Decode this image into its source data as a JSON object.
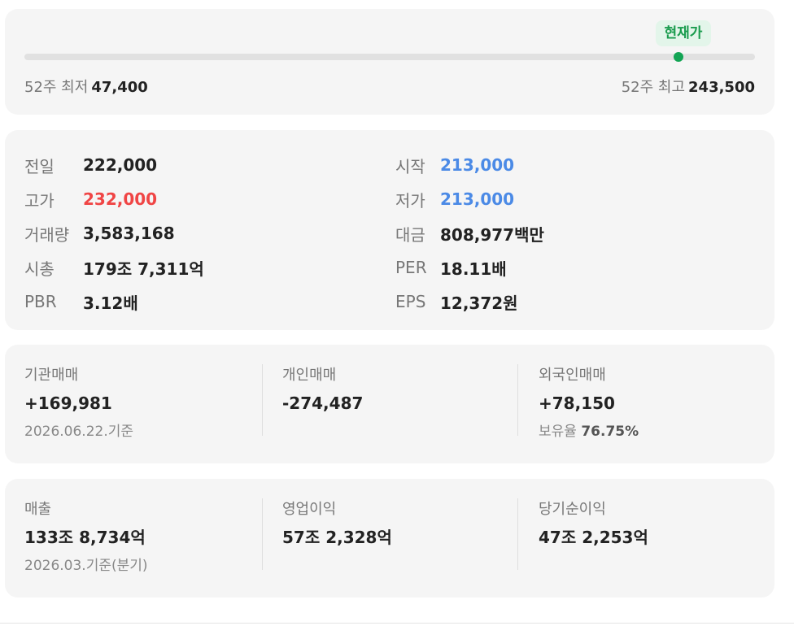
{
  "range": {
    "current_badge": "현재가",
    "current_position": 0.895,
    "low_label": "52주 최저",
    "low_value": "47,400",
    "high_label": "52주 최고",
    "high_value": "243,500",
    "track_color": "#e1e1e1",
    "dot_color": "#13a454"
  },
  "stats": {
    "left": [
      {
        "label": "전일",
        "value": "222,000",
        "color": "default"
      },
      {
        "label": "고가",
        "value": "232,000",
        "color": "red"
      },
      {
        "label": "거래량",
        "value": "3,583,168",
        "color": "default"
      },
      {
        "label": "시총",
        "value": "179조 7,311억",
        "color": "default"
      },
      {
        "label": "PBR",
        "value": "3.12배",
        "color": "default"
      }
    ],
    "right": [
      {
        "label": "시작",
        "value": "213,000",
        "color": "blue"
      },
      {
        "label": "저가",
        "value": "213,000",
        "color": "blue"
      },
      {
        "label": "대금",
        "value": "808,977백만",
        "color": "default"
      },
      {
        "label": "PER",
        "value": "18.11배",
        "color": "default"
      },
      {
        "label": "EPS",
        "value": "12,372원",
        "color": "default"
      }
    ]
  },
  "trading": {
    "institution_label": "기관매매",
    "institution_value": "+169,981",
    "individual_label": "개인매매",
    "individual_value": "-274,487",
    "foreign_label": "외국인매매",
    "foreign_value": "+78,150",
    "as_of": "2026.06.22.기준",
    "holding_label": "보유율",
    "holding_value": "76.75%"
  },
  "finance": {
    "revenue_label": "매출",
    "revenue_value": "133조 8,734억",
    "operating_label": "영업이익",
    "operating_value": "57조 2,328억",
    "net_label": "당기순이익",
    "net_value": "47조 2,253억",
    "as_of": "2026.03.기준(분기)"
  },
  "colors": {
    "up": "#f04545",
    "down": "#4b8ae6",
    "accent_green": "#1a9c4e"
  }
}
